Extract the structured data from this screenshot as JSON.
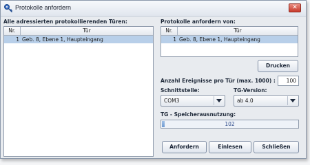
{
  "window": {
    "title": "Protokolle anfordern",
    "close_symbol": "✕"
  },
  "left_panel": {
    "label": "Alle adressierten protokollierenden Türen:",
    "columns": {
      "nr": "Nr.",
      "tuer": "Tür"
    },
    "rows": [
      {
        "nr": "1",
        "tuer": "Geb. 8, Ebene 1, Haupteingang"
      }
    ]
  },
  "right_panel": {
    "label": "Protokolle anfordern von:",
    "columns": {
      "nr": "Nr.",
      "tuer": "Tür"
    },
    "rows": [
      {
        "nr": "1",
        "tuer": "Geb. 8, Ebene 1, Haupteingang"
      }
    ]
  },
  "drucken_label": "Drucken",
  "events": {
    "label": "Anzahl Ereignisse pro Tür (max. 1000) :",
    "value": "100"
  },
  "schnittstelle": {
    "label": "Schnittstelle:",
    "value": "COM3"
  },
  "tg_version": {
    "label": "TG-Version:",
    "value": "ab 4.0"
  },
  "speicher": {
    "label": "TG - Speicherausnutzung:",
    "value": "102",
    "fill_fraction": 0.02
  },
  "buttons": {
    "anfordern": "Anfordern",
    "einlesen": "Einlesen",
    "schliessen": "Schließen"
  },
  "colors": {
    "selection": "#b8cfe9",
    "accent": "#6f9ad0"
  },
  "icons": {
    "app": "key-icon",
    "close": "close-icon",
    "dropdown": "chevron-down-icon"
  }
}
